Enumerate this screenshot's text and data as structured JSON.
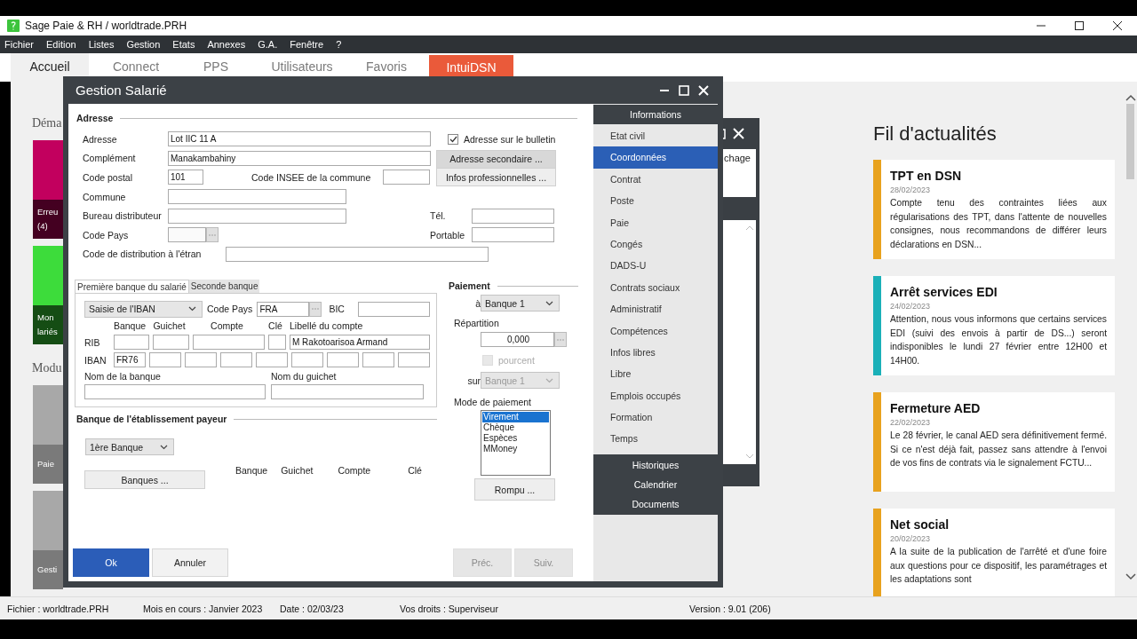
{
  "app": {
    "title": "Sage Paie & RH / worldtrade.PRH"
  },
  "menu": [
    "Fichier",
    "Edition",
    "Listes",
    "Gestion",
    "Etats",
    "Annexes",
    "G.A.",
    "Fenêtre",
    "?"
  ],
  "tabs": [
    {
      "label": "Accueil",
      "selected": true,
      "kind": "normal"
    },
    {
      "label": "Connect",
      "selected": false,
      "kind": "normal"
    },
    {
      "label": "PPS",
      "selected": false,
      "kind": "normal"
    },
    {
      "label": "Utilisateurs",
      "selected": false,
      "kind": "normal"
    },
    {
      "label": "Favoris",
      "selected": false,
      "kind": "normal"
    },
    {
      "label": "IntuiDSN",
      "selected": false,
      "kind": "promo"
    }
  ],
  "home": {
    "sections": [
      {
        "heading": "Déma",
        "tiles": [
          {
            "lines": [
              "Erreu",
              "(4)"
            ],
            "color": "#c2005e"
          },
          {
            "lines": [
              "Mon",
              "lariés"
            ],
            "color": "#3ddc3b"
          }
        ]
      },
      {
        "heading": "Modu",
        "tiles": [
          {
            "lines": [
              "Paie"
            ],
            "color": "#a8a8a8"
          },
          {
            "lines": [
              "Gesti"
            ],
            "color": "#a8a8a8"
          }
        ]
      }
    ]
  },
  "back_window": {
    "text": "chage"
  },
  "news": {
    "title": "Fil d'actualités",
    "items": [
      {
        "title": "TPT en DSN",
        "date": "28/02/2023",
        "body": "Compte tenu des contraintes liées aux régularisations des TPT, dans l'attente de nouvelles consignes, nous recommandons de différer leurs déclarations en DSN...",
        "color": "#e8a21e"
      },
      {
        "title": "Arrêt services EDI",
        "date": "24/02/2023",
        "body": "Attention, nous vous informons que certains services EDI (suivi des envois à partir de DS...) seront indisponibles le lundi 27 février entre 12H00 et 14H00.",
        "color": "#1ab0b8"
      },
      {
        "title": "Fermeture AED",
        "date": "22/02/2023",
        "body": "Le 28 février, le canal AED sera définitivement fermé. Si ce n'est déjà fait, passez sans attendre à l'envoi de vos fins de contrats via le signalement FCTU...",
        "color": "#e8a21e"
      },
      {
        "title": "Net social",
        "date": "20/02/2023",
        "body": "A la suite de la publication de l'arrêté et d'une foire aux questions pour ce dispositif, les paramétrages et les adaptations sont",
        "color": "#e8a21e"
      }
    ]
  },
  "dialog": {
    "title": "Gestion Salarié",
    "address": {
      "legend": "Adresse",
      "adresse": {
        "label": "Adresse",
        "value": "Lot IIC 11 A"
      },
      "complement": {
        "label": "Complément",
        "value": "Manakambahiny"
      },
      "code_postal": {
        "label": "Code postal",
        "value": "101"
      },
      "code_insee": {
        "label": "Code INSEE de la commune"
      },
      "commune": {
        "label": "Commune"
      },
      "bureau": {
        "label": "Bureau distributeur"
      },
      "code_pays": {
        "label": "Code Pays"
      },
      "code_distribution": {
        "label": "Code de distribution à l'étran"
      },
      "on_bulletin": {
        "label": "Adresse sur le bulletin",
        "checked": true
      },
      "secondary_button": "Adresse secondaire ...",
      "pro_button": "Infos professionnelles ...",
      "tel": {
        "label": "Tél."
      },
      "portable": {
        "label": "Portable"
      }
    },
    "bank_tabs": [
      {
        "label": "Première banque du salarié",
        "selected": true
      },
      {
        "label": "Seconde banque",
        "selected": false
      }
    ],
    "bank": {
      "mode": "Saisie de l'IBAN",
      "code_pays": {
        "label": "Code Pays",
        "value": "FRA"
      },
      "bic": {
        "label": "BIC"
      },
      "rib_headers": [
        "Banque",
        "Guichet",
        "Compte",
        "Clé",
        "Libellé du compte"
      ],
      "rib_label": "RIB",
      "account_name": "M Rakotoarisoa Armand",
      "iban_label": "IBAN",
      "iban_prefix": "FR76",
      "bank_name_label": "Nom de la banque",
      "branch_name_label": "Nom du guichet"
    },
    "payer": {
      "legend": "Banque de l'établissement payeur",
      "select": "1ère Banque",
      "button": "Banques ...",
      "headers": [
        "Banque",
        "Guichet",
        "Compte",
        "Clé"
      ]
    },
    "payment": {
      "legend": "Paiement",
      "to_label": "à",
      "to_value": "Banque 1",
      "split_label": "Répartition",
      "split_value": "0,000",
      "percent": {
        "label": "pourcent",
        "checked": false,
        "disabled": true
      },
      "on_label": "sur",
      "on_select": {
        "value": "Banque 1",
        "disabled": true
      },
      "mode_label": "Mode de paiement",
      "modes": [
        {
          "label": "Virement",
          "selected": true
        },
        {
          "label": "Chèque",
          "selected": false
        },
        {
          "label": "Espèces",
          "selected": false
        },
        {
          "label": "MMoney",
          "selected": false
        }
      ],
      "rounding_button": "Rompu ..."
    },
    "footer": [
      {
        "label": "Ok",
        "kind": "primary",
        "disabled": false
      },
      {
        "label": "Annuler",
        "kind": "normal",
        "disabled": false
      },
      {
        "label": "Préc.",
        "kind": "nav",
        "disabled": true
      },
      {
        "label": "Suiv.",
        "kind": "nav",
        "disabled": true
      }
    ],
    "nav": {
      "header": "Informations",
      "items": [
        {
          "label": "Etat civil",
          "selected": false
        },
        {
          "label": "Coordonnées",
          "selected": true
        },
        {
          "label": "Contrat",
          "selected": false
        },
        {
          "label": "Poste",
          "selected": false
        },
        {
          "label": "Paie",
          "selected": false
        },
        {
          "label": "Congés",
          "selected": false
        },
        {
          "label": "DADS-U",
          "selected": false
        },
        {
          "label": "Contrats sociaux",
          "selected": false
        },
        {
          "label": "Administratif",
          "selected": false
        },
        {
          "label": "Compétences",
          "selected": false
        },
        {
          "label": "Infos libres",
          "selected": false
        },
        {
          "label": "Libre",
          "selected": false
        },
        {
          "label": "Emplois occupés",
          "selected": false
        },
        {
          "label": "Formation",
          "selected": false
        },
        {
          "label": "Temps",
          "selected": false
        }
      ],
      "footer_items": [
        "Historiques",
        "Calendrier",
        "Documents"
      ]
    }
  },
  "status_bar": [
    "Fichier : worldtrade.PRH",
    "Mois en cours : Janvier 2023",
    "Date : 02/03/23",
    "Vos droits : Superviseur",
    "Version : 9.01 (206)"
  ]
}
